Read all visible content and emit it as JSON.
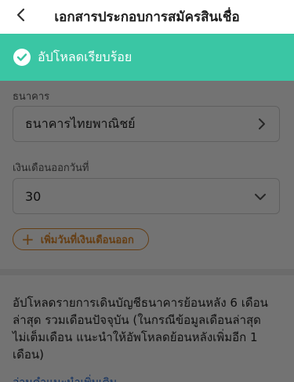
{
  "header": {
    "title": "เอกสารประกอบการสมัครสินเชื่อ"
  },
  "banner": {
    "message": "อัปโหลดเรียบร้อย"
  },
  "form": {
    "bank_label": "ธนาคาร",
    "bank_value": "ธนาคารไทยพาณิชย์",
    "payday_label": "เงินเดือนออกวันที่",
    "payday_value": "30",
    "add_payday_label": "เพิ่มวันที่เงินเดือนออก"
  },
  "info": {
    "text": "อัปโหลดรายการเดินบัญชีธนาคารย้อนหลัง 6 เดือนล่าสุด รวมเดือนปัจจุบัน (ในกรณีข้อมูลเดือนล่าสุดไม่เต็มเดือน แนะนำให้อัพโหลดย้อนหลังเพิ่มอีก 1 เดือน)",
    "link_partial": "อ่านคำแนะนำเพิ่มเติม"
  },
  "colors": {
    "success": "#3ac6a4",
    "accent": "#e08a2d",
    "link": "#1e64d2"
  }
}
